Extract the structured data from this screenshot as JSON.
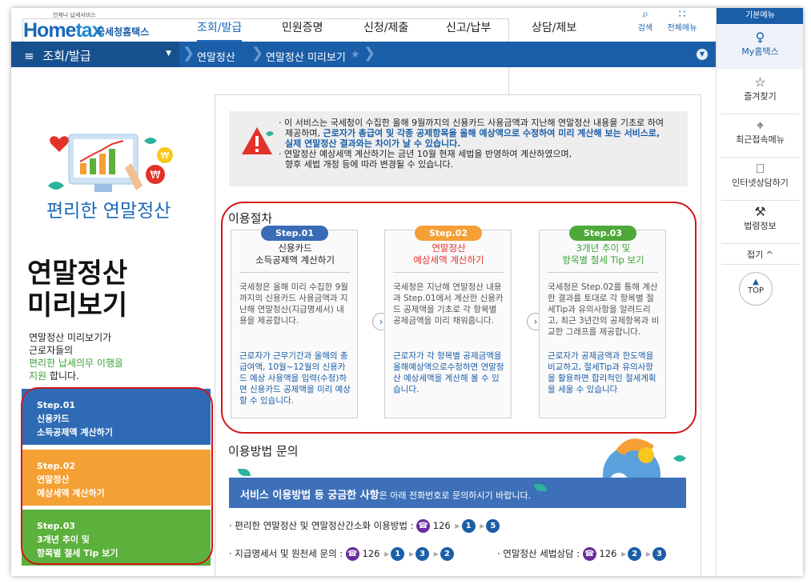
{
  "header": {
    "logo_small": "언제나 납세서비스",
    "logo_main_a": "Home",
    "logo_main_b": "tax",
    "logo_kr": "국세청홈택스",
    "nav": [
      "조회/발급",
      "민원증명",
      "신청/제출",
      "신고/납부",
      "상담/제보"
    ],
    "search_label": "검색",
    "allmenu_label": "전체메뉴"
  },
  "subnav": {
    "menu_label": "조회/발급",
    "crumbs": [
      "연말정산",
      "연말정산 미리보기"
    ]
  },
  "right": {
    "top_label": "기본메뉴",
    "items": [
      "My홈택스",
      "즐겨찾기",
      "최근접속메뉴",
      "인터넷상담하기",
      "법령정보"
    ],
    "fold_label": "접기 ^",
    "top_button": "TOP"
  },
  "left": {
    "caption": "편리한 연말정산",
    "big_title_1": "연말정산",
    "big_title_2": "미리보기",
    "desc_1": "연말정산 미리보기가",
    "desc_2": "근로자들의",
    "desc_3": "편리한 납세의무 이행을",
    "desc_4a": "지원",
    "desc_4b": " 합니다.",
    "steps": [
      {
        "l1": "Step.01",
        "l2": "신용카드",
        "l3": "소득공제액 계산하기",
        "color": "#2f6bb5"
      },
      {
        "l1": "Step.02",
        "l2": "연말정산",
        "l3": "예상세액 계산하기",
        "color": "#f4a035"
      },
      {
        "l1": "Step.03",
        "l2": "3개년 추이 및",
        "l3": "항목별 절세 Tip 보기",
        "color": "#5cb03c"
      }
    ]
  },
  "notice": {
    "l1": "· 이 서비스는 국세청이 수집한 올해 9월까지의 신용카드 사용금액과 지난해 연말정산 내용을 기초로 하여",
    "l2a": "제공하며, ",
    "l2b": "근로자가 총급여 및 각종 공제항목을 올해 예상액으로 수정하여 미리 계산해 보는 서비스로,",
    "l3": "실제 연말정산 결과와는 차이가 날 수 있습니다.",
    "l4": "· 연말정산 예상세액 계산하기는 금년 10월 현재 세법을 반영하여 계산하였으며,",
    "l5": "향후 세법 개정 등에 따라 변경될 수 있습니다."
  },
  "procedure": {
    "title": "이용절차",
    "cards": [
      {
        "pill": "Step.01",
        "pill_color": "#3a6bb5",
        "t1": "신용카드",
        "t2": "소득공제액 계산하기",
        "title_color": "#222222",
        "body": "국세청은 올해 미리 수집한 9월까지의 신용카드 사용금액과 지난해 연말정산(지급명세서) 내용을 제공합니다.",
        "blue": "근로자가 근무기간과 올해의 총급여액, 10월~12월의 신용카드 예상 사용액을 입력(수정)하면 신용카드 공제액을 미리 예상할 수 있습니다."
      },
      {
        "pill": "Step.02",
        "pill_color": "#f4a035",
        "t1": "연말정산",
        "t2": "예상세액 계산하기",
        "title_color": "#e3322a",
        "body": "국세청은 지난해 연말정산 내용과 Step.01에서 계산한 신용카드 공제액을 기초로 각 항목별 공제금액을 미리 채워줍니다.",
        "blue": "근로자가 각 항목별 공제금액을 올해예상액으로수정하면 연말정산 예상세액을 계산해 볼 수 있습니다."
      },
      {
        "pill": "Step.03",
        "pill_color": "#4ea83a",
        "t1": "3개년 추이 및",
        "t2": "항목별 절세 Tip 보기",
        "title_color": "#3aa23a",
        "body": "국세청은 Step.02를 통해 계산한 결과를 토대로 각 항목별 절세Tip과 유의사항을 알려드리고, 최근 3년간의 공제항목과 비교한 그래프를 제공합니다.",
        "blue": "근로자가 공제금액과 한도액을 비교하고, 절세Tip과 유의사항을 활용하면 합리적인 절세계획을 세울 수 있습니다"
      }
    ]
  },
  "inquiry": {
    "title": "이용방법 문의",
    "banner_bold": "서비스 이용방법 등 궁금한 사항",
    "banner_rest": "은 아래 전화번호로 문의하시기 바랍니다.",
    "q1_label": "· 편리한 연말정산 및 연말정산간소화 이용방법 :",
    "q1_codes": [
      "126",
      "1",
      "5"
    ],
    "q2_label": "· 지급명세서 및 원천세 문의 :",
    "q2_codes": [
      "126",
      "1",
      "3",
      "2"
    ],
    "q3_label": "· 연말정산 세법상담 :",
    "q3_codes": [
      "126",
      "2",
      "3"
    ]
  },
  "colors": {
    "brand": "#1b5ea8",
    "annotation": "#d3161a"
  }
}
